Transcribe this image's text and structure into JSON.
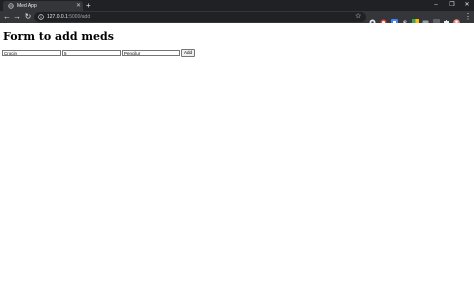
{
  "browser": {
    "tab": {
      "title": "Med App",
      "favicon": "globe-icon"
    },
    "url_host": "127.0.0.1",
    "url_path": ":5000/add",
    "extensions": [
      {
        "name": "extension-icon-1",
        "color": "#e8eaed"
      },
      {
        "name": "extension-icon-2",
        "color": "#ea4335"
      },
      {
        "name": "extension-icon-3",
        "color": "#4285f4"
      },
      {
        "name": "extension-icon-4",
        "color": "#e8eaed"
      },
      {
        "name": "extension-icon-5",
        "color": "#34a853"
      },
      {
        "name": "extension-icon-6",
        "color": "#9aa0a6"
      },
      {
        "name": "extension-icon-7",
        "color": "#5f6368"
      },
      {
        "name": "profile-icon",
        "color": "#f28b82"
      }
    ]
  },
  "page": {
    "title": "Form to add meds",
    "form": {
      "field1_value": "Crocin",
      "field2_value": "5",
      "field3_value": "Pencilur",
      "submit_label": "Add"
    }
  }
}
